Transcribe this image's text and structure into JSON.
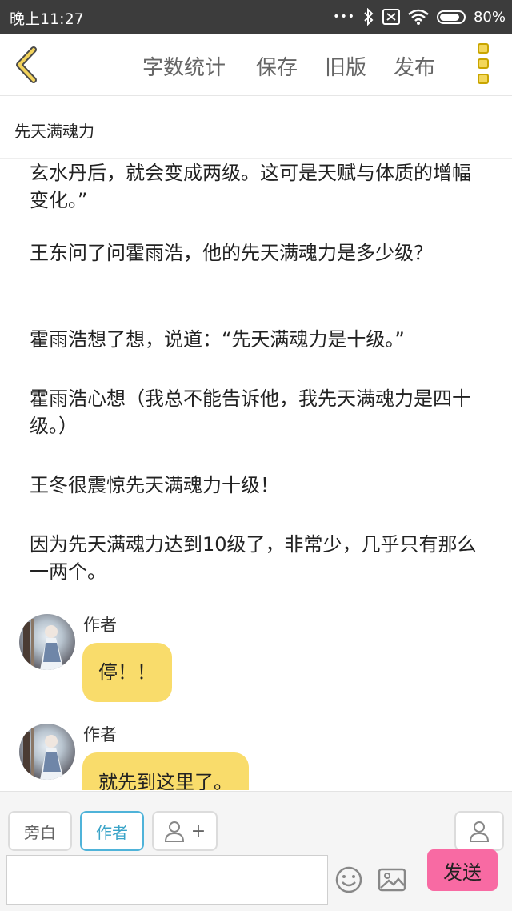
{
  "status_bar": {
    "time": "晚上11:27",
    "battery": "80%"
  },
  "header": {
    "nav": [
      "字数统计",
      "保存",
      "旧版",
      "发布"
    ]
  },
  "chapter": {
    "title": "先天满魂力"
  },
  "paragraphs": [
    "玄水丹后，就会变成两级。这可是天赋与体质的增幅变化。”",
    "王东问了问霍雨浩，他的先天满魂力是多少级？",
    "霍雨浩想了想，说道：“先天满魂力是十级。”",
    "霍雨浩心想（我总不能告诉他，我先天满魂力是四十级。）",
    "王冬很震惊先天满魂力十级！",
    "因为先天满魂力达到10级了，非常少，几乎只有那么一两个。"
  ],
  "messages": [
    {
      "author": "作者",
      "text": "停！！"
    },
    {
      "author": "作者",
      "text": "就先到这里了。"
    }
  ],
  "toolbar": {
    "narration": "旁白",
    "author": "作者",
    "add_role": "+",
    "input_placeholder": "",
    "send": "发送"
  },
  "colors": {
    "bubble": "#f9dc6b",
    "send": "#f86aa3",
    "accent": "#4fb3d9",
    "back_arrow": "#c9a500"
  },
  "icons": [
    "back-arrow-icon",
    "menu-icon",
    "emoji-icon",
    "image-icon",
    "person-icon",
    "add-person-icon"
  ]
}
